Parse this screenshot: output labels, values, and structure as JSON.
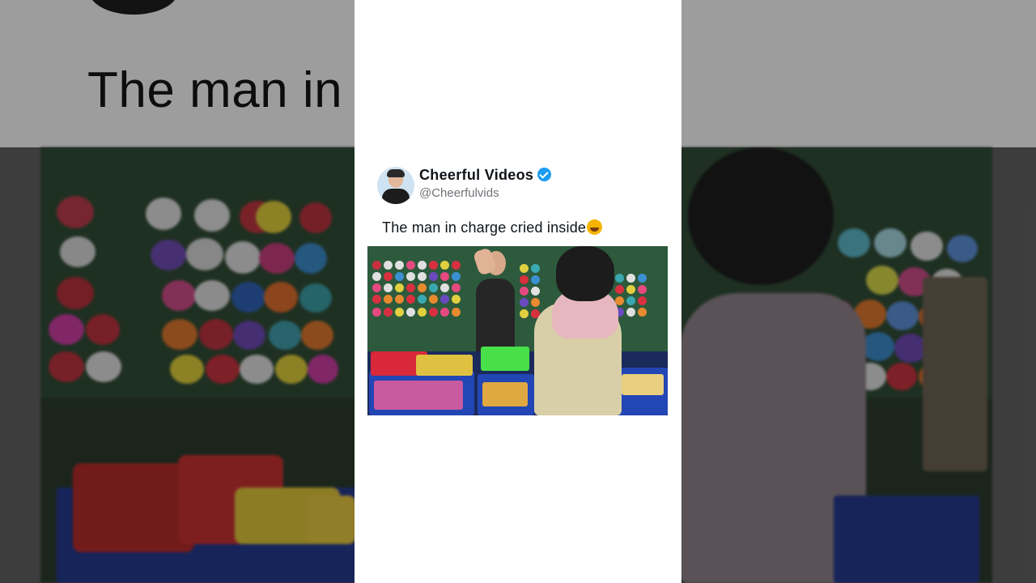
{
  "post": {
    "author_name": "Cheerful Videos",
    "handle": "@Cheerfulvids",
    "verified": true,
    "caption": "The man in charge cried inside",
    "caption_emoji": "face-with-tears-of-joy"
  },
  "background": {
    "caption_text": "The man in                                                 inside",
    "style": "blurred enlarged copy of the post"
  },
  "colors": {
    "verified_badge": "#1d9bf0",
    "card_background": "#ffffff",
    "name_text": "#0f1419",
    "handle_text": "#6e7378"
  }
}
